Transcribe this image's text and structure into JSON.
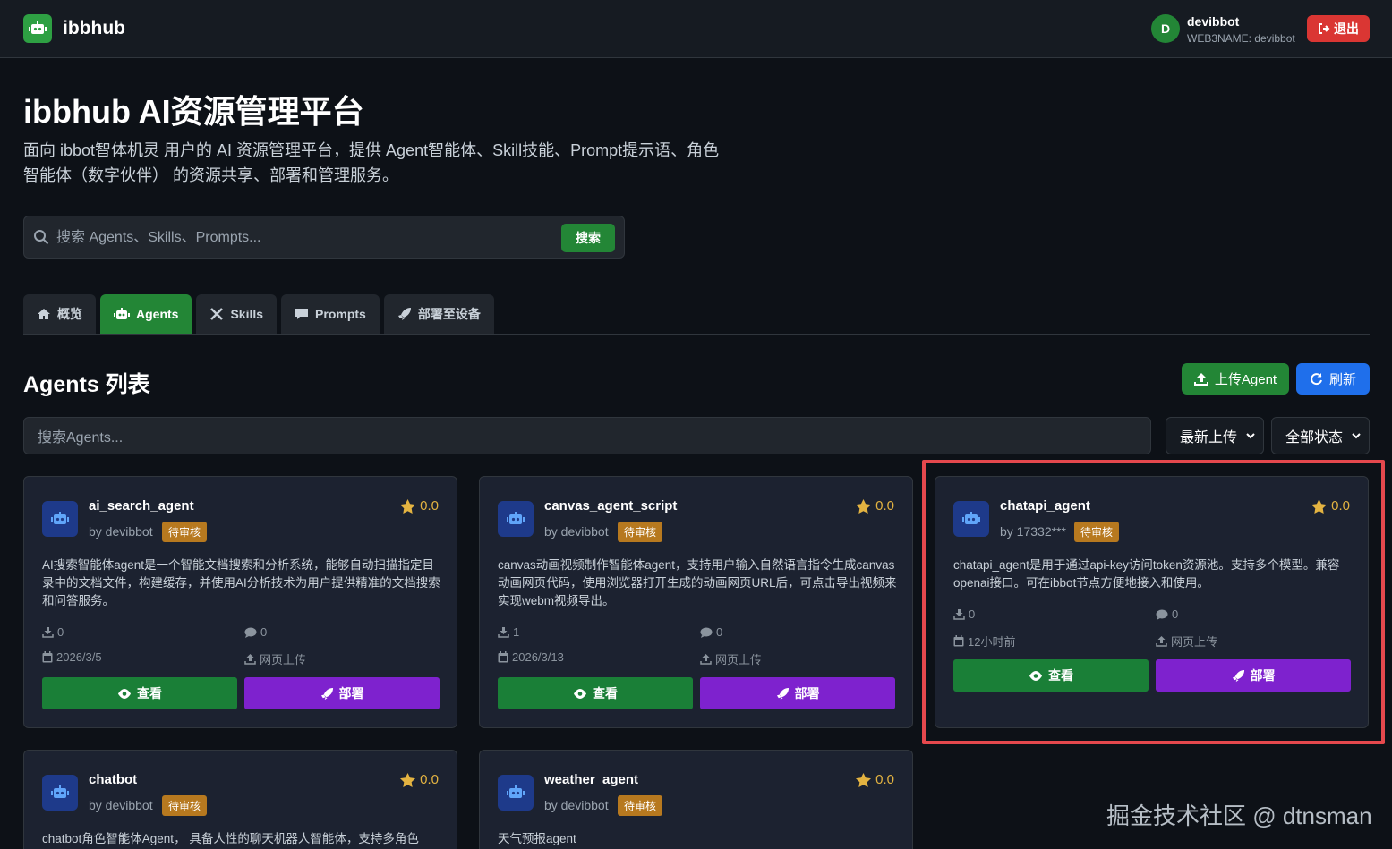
{
  "header": {
    "brand": "ibbhub",
    "user_initial": "D",
    "user_name": "devibbot",
    "user_sub": "WEB3NAME: devibbot",
    "logout_label": "退出"
  },
  "hero": {
    "title": "ibbhub AI资源管理平台",
    "description": "面向 ibbot智体机灵 用户的 AI 资源管理平台，提供 Agent智能体、Skill技能、Prompt提示语、角色智能体（数字伙伴） 的资源共享、部署和管理服务。",
    "search_placeholder": "搜索 Agents、Skills、Prompts...",
    "search_button": "搜索"
  },
  "tabs": [
    {
      "label": "概览",
      "icon": "home-icon"
    },
    {
      "label": "Agents",
      "icon": "robot-icon",
      "active": true
    },
    {
      "label": "Skills",
      "icon": "tools-icon"
    },
    {
      "label": "Prompts",
      "icon": "comment-icon"
    },
    {
      "label": "部署至设备",
      "icon": "rocket-icon"
    }
  ],
  "section": {
    "title": "Agents 列表",
    "upload_label": "上传Agent",
    "refresh_label": "刷新",
    "filter_placeholder": "搜索Agents...",
    "sort_value": "最新上传",
    "status_value": "全部状态"
  },
  "cards": [
    {
      "name": "ai_search_agent",
      "by": "by devibbot",
      "badge": "待审核",
      "rating": "0.0",
      "desc": "AI搜索智能体agent是一个智能文档搜索和分析系统，能够自动扫描指定目录中的文档文件，构建缓存，并使用AI分析技术为用户提供精准的文档搜索和问答服务。",
      "downloads": "0",
      "comments": "0",
      "date": "2026/3/5",
      "source": "网页上传",
      "view": "查看",
      "deploy": "部署"
    },
    {
      "name": "canvas_agent_script",
      "by": "by devibbot",
      "badge": "待审核",
      "rating": "0.0",
      "desc": "canvas动画视频制作智能体agent，支持用户输入自然语言指令生成canvas动画网页代码，使用浏览器打开生成的动画网页URL后，可点击导出视频来实现webm视频导出。",
      "downloads": "1",
      "comments": "0",
      "date": "2026/3/13",
      "source": "网页上传",
      "view": "查看",
      "deploy": "部署"
    },
    {
      "name": "chatapi_agent",
      "by": "by 17332***",
      "badge": "待审核",
      "rating": "0.0",
      "desc": "chatapi_agent是用于通过api-key访问token资源池。支持多个模型。兼容openai接口。可在ibbot节点方便地接入和使用。",
      "downloads": "0",
      "comments": "0",
      "date": "12小时前",
      "source": "网页上传",
      "view": "查看",
      "deploy": "部署"
    },
    {
      "name": "chatbot",
      "by": "by devibbot",
      "badge": "待审核",
      "rating": "0.0",
      "desc": "chatbot角色智能体Agent， 具备人性的聊天机器人智能体，支持多角色"
    },
    {
      "name": "weather_agent",
      "by": "by devibbot",
      "badge": "待审核",
      "rating": "0.0",
      "desc": "天气预报agent"
    }
  ],
  "watermark": "掘金技术社区 @ dtnsman",
  "colors": {
    "background": "#0d1117",
    "surface": "#1c2230",
    "primary_green": "#238636",
    "deploy_purple": "#7e22ce",
    "refresh_blue": "#1f6feb",
    "badge_amber": "#b7791f",
    "logout_red": "#da3633",
    "highlight_red": "#e5484d"
  }
}
